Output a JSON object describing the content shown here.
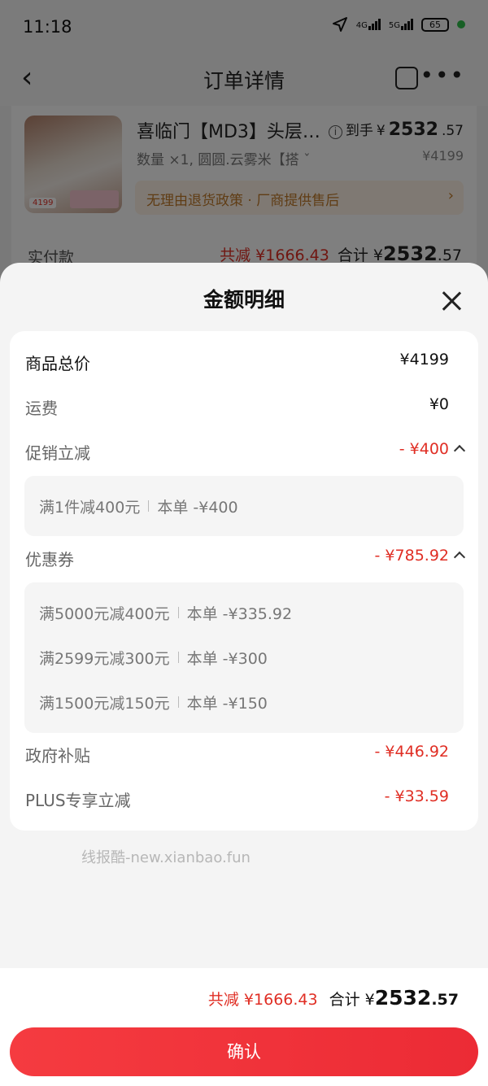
{
  "status_bar": {
    "time": "11:18",
    "network_1": "4G",
    "network_2": "5G",
    "battery": "65"
  },
  "nav": {
    "back_icon": "chevron-left-icon",
    "title": "订单详情",
    "share_icon": "share-icon",
    "more_icon": "more-icon"
  },
  "order": {
    "product_name": "喜临门【MD3】头层…",
    "final_price_prefix": "到手",
    "final_price_yen": "¥",
    "final_price_int": "2532",
    "final_price_dec": ".57",
    "spec": "数量 ×1, 圆圆.云雾米【搭 ˇ",
    "original_price": "¥4199",
    "image_price": "4199",
    "return_policy": "无理由退货政策 · 厂商提供售后",
    "paid_label": "实付款",
    "paid_reduce": "共减 ¥1666.43",
    "paid_total_label": "合计 ¥",
    "paid_total_int": "2532",
    "paid_total_dec": ".57"
  },
  "sheet": {
    "title": "金额明细",
    "close_icon": "close-icon",
    "rows": {
      "total_price": {
        "label": "商品总价",
        "value": "¥4199"
      },
      "shipping": {
        "label": "运费",
        "value": "¥0"
      },
      "promo": {
        "label": "促销立减",
        "value": "- ¥400"
      },
      "coupon": {
        "label": "优惠券",
        "value": "- ¥785.92"
      },
      "subsidy": {
        "label": "政府补贴",
        "value": "- ¥446.92"
      },
      "plus": {
        "label": "PLUS专享立减",
        "value": "- ¥33.59"
      }
    },
    "promo_items": [
      {
        "rule": "满1件减400元",
        "amount": "本单 -¥400"
      }
    ],
    "coupon_items": [
      {
        "rule": "满5000元减400元",
        "amount": "本单 -¥335.92"
      },
      {
        "rule": "满2599元减300元",
        "amount": "本单 -¥300"
      },
      {
        "rule": "满1500元减150元",
        "amount": "本单 -¥150"
      }
    ]
  },
  "watermark": "线报酷-new.xianbao.fun",
  "footer": {
    "reduce": "共减 ¥1666.43",
    "total_label": "合计 ¥",
    "total_int": "2532",
    "total_dec": ".57",
    "confirm_label": "确认"
  },
  "colors": {
    "accent_red": "#e02e24",
    "button_red": "#f53b40",
    "return_text": "#c07a2a"
  }
}
